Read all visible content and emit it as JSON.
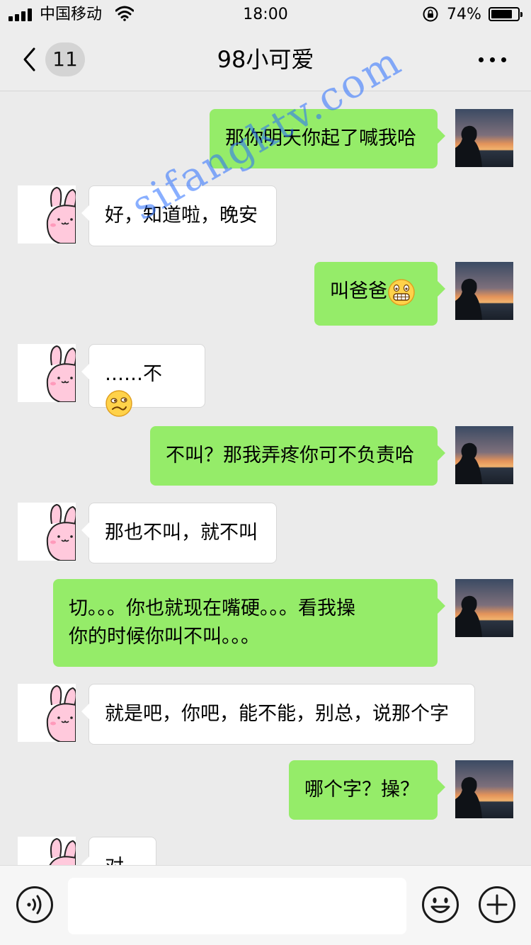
{
  "status_bar": {
    "carrier": "中国移动",
    "time": "18:00",
    "battery_percent": "74%",
    "battery_level": 0.74,
    "icons": [
      "signal-icon",
      "wifi-icon",
      "rotation-lock-icon",
      "battery-icon"
    ]
  },
  "nav": {
    "back_badge": "11",
    "title": "98小可爱",
    "icons": [
      "back-chevron-icon",
      "more-icon"
    ]
  },
  "messages": [
    {
      "side": "out",
      "text": "那你明天你起了喊我哈"
    },
    {
      "side": "in",
      "text": "好，知道啦，晚安"
    },
    {
      "side": "out",
      "text": "叫爸爸",
      "emoji": "grinning-face-icon"
    },
    {
      "side": "in",
      "text": "……不",
      "emoji": "smirk-face-icon"
    },
    {
      "side": "out",
      "text": "不叫？那我弄疼你可不负责哈"
    },
    {
      "side": "in",
      "text": "那也不叫，就不叫"
    },
    {
      "side": "out",
      "text": "切。。。你也就现在嘴硬。。。看我操\n你的时候你叫不叫。。。"
    },
    {
      "side": "in",
      "text": "就是吧，你吧，能不能，别总，说那个字"
    },
    {
      "side": "out",
      "text": "哪个字？操？"
    },
    {
      "side": "in",
      "text": "对"
    }
  ],
  "watermark": "sifangktv.com",
  "colors": {
    "background": "#ebebeb",
    "outgoing_bubble": "#95ec69",
    "incoming_bubble": "#ffffff",
    "watermark": "#3c78ff"
  },
  "input_bar": {
    "placeholder": "",
    "icons": [
      "voice-icon",
      "emoji-icon",
      "plus-icon"
    ]
  }
}
